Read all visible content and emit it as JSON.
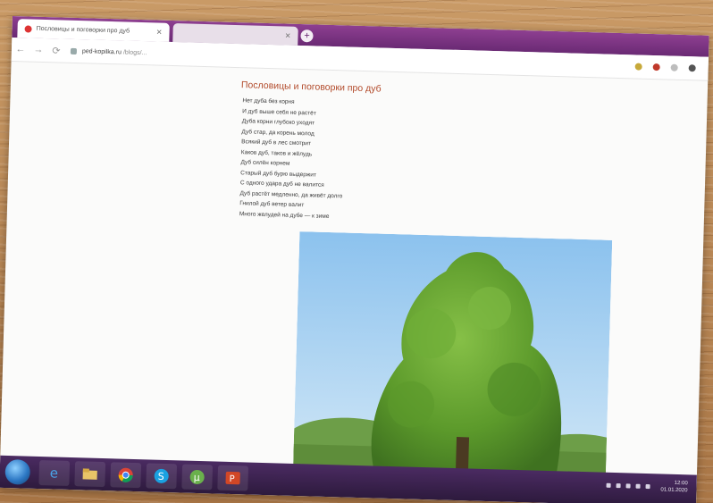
{
  "browser": {
    "tabs": [
      {
        "label": "Пословицы и поговорки про дуб",
        "active": true
      },
      {
        "label": "",
        "active": false
      }
    ],
    "address": {
      "domain": "ped-kopilka.ru",
      "path": "/blogs/..."
    }
  },
  "page": {
    "title": "Пословицы и поговорки про дуб",
    "proverbs": [
      "Нет дуба без корня",
      "И дуб выше себя не растёт",
      "Дуба корни глубоко уходят",
      "Дуб стар, да корень молод",
      "Всякий дуб в лес смотрит",
      "Каков дуб, таков и жёлудь",
      "Дуб силён корнем",
      "Старый дуб бурю выдержит",
      "С одного удара дуб не валится",
      "Дуб растёт медленно, да живёт долго",
      "Гнилой дуб ветер валит",
      "Много желудей на дубе — к зиме"
    ]
  },
  "taskbar": {
    "apps": [
      "internet-explorer-icon",
      "file-explorer-icon",
      "chrome-icon",
      "skype-icon",
      "utorrent-icon",
      "powerpoint-icon"
    ],
    "clock_time": "12:00",
    "clock_date": "01.01.2020"
  },
  "colors": {
    "tabbar": "#7a3482",
    "title": "#b24a2a",
    "sky": "#9fcaf0",
    "foliage": "#5f9e2e"
  }
}
